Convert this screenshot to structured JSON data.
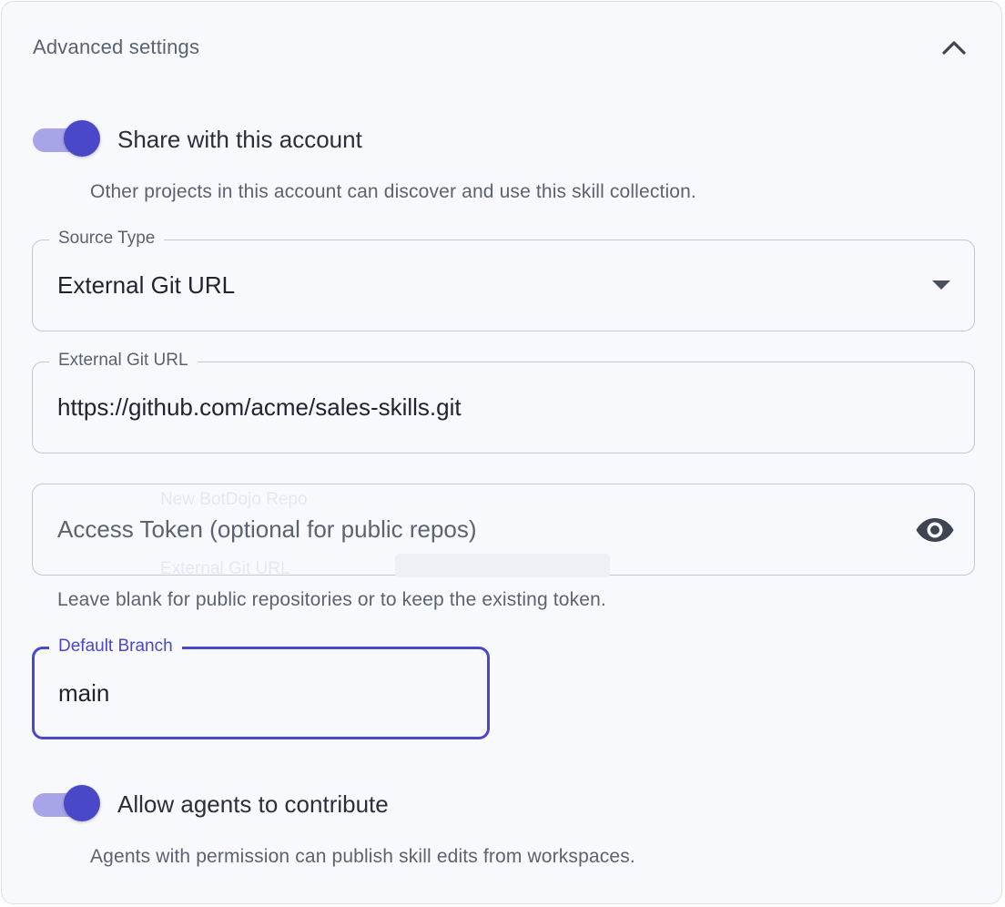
{
  "header": {
    "title": "Advanced settings"
  },
  "share_toggle": {
    "label": "Share with this account",
    "checked": true,
    "helper": "Other projects in this account can discover and use this skill collection."
  },
  "source_type": {
    "label": "Source Type",
    "value": "External Git URL"
  },
  "git_url": {
    "label": "External Git URL",
    "value": "https://github.com/acme/sales-skills.git"
  },
  "access_token": {
    "placeholder": "Access Token (optional for public repos)",
    "helper": "Leave blank for public repositories or to keep the existing token."
  },
  "default_branch": {
    "label": "Default Branch",
    "value": "main"
  },
  "contribute_toggle": {
    "label": "Allow agents to contribute",
    "checked": true,
    "helper": "Agents with permission can publish skill edits from workspaces."
  },
  "ghost_menu": {
    "option_1": "New BotDojo Repo",
    "option_2": "External Git URL"
  },
  "colors": {
    "accent": "#4a47c9",
    "accent_light": "#a7a4e8",
    "panel_bg": "#f8f9fd",
    "border": "#c4c7cf"
  },
  "icons": {
    "collapse": "chevron-up-icon",
    "dropdown": "caret-down-icon",
    "visibility": "eye-icon"
  }
}
